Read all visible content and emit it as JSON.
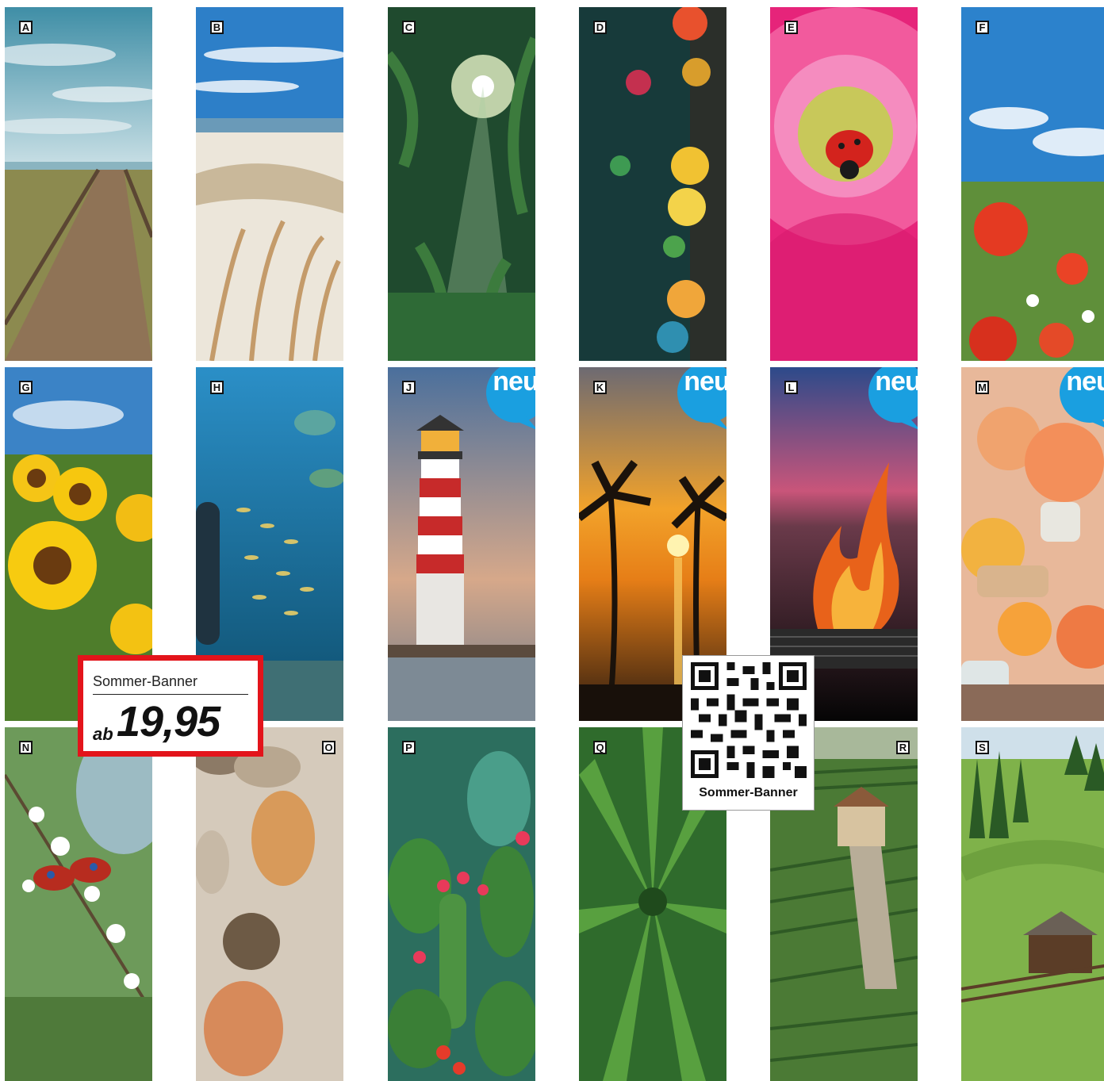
{
  "tiles": [
    {
      "letter": "A",
      "subject": "boardwalk to beach under cloudy sky",
      "is_new": false
    },
    {
      "letter": "B",
      "subject": "sand dunes with beach grass",
      "is_new": false
    },
    {
      "letter": "C",
      "subject": "sunlit jungle with palms",
      "is_new": false
    },
    {
      "letter": "D",
      "subject": "colorful lanterns in garden",
      "is_new": false
    },
    {
      "letter": "E",
      "subject": "pink dahlia with ladybug",
      "is_new": false
    },
    {
      "letter": "F",
      "subject": "poppy field under blue sky",
      "is_new": false
    },
    {
      "letter": "G",
      "subject": "sunflower field",
      "is_new": false
    },
    {
      "letter": "H",
      "subject": "aquarium with fish swarm",
      "is_new": false
    },
    {
      "letter": "J",
      "subject": "red and white lighthouse at pier",
      "is_new": true
    },
    {
      "letter": "K",
      "subject": "palm trees at sunset over sea",
      "is_new": true
    },
    {
      "letter": "L",
      "subject": "barbecue flames at dusk",
      "is_new": true
    },
    {
      "letter": "M",
      "subject": "peach ice tea with fruit",
      "is_new": true
    },
    {
      "letter": "N",
      "subject": "peacock butterfly on blossom branch",
      "is_new": false
    },
    {
      "letter": "O",
      "subject": "sea shells on sand",
      "is_new": false
    },
    {
      "letter": "P",
      "subject": "blooming cactus",
      "is_new": false
    },
    {
      "letter": "Q",
      "subject": "green lily leaves with dew",
      "is_new": false
    },
    {
      "letter": "R",
      "subject": "vineyard with stone house",
      "is_new": false
    },
    {
      "letter": "S",
      "subject": "alpine meadow with wooden hut",
      "is_new": false
    }
  ],
  "badges": {
    "new_label": "neu"
  },
  "price_tag": {
    "title": "Sommer-Banner",
    "prefix": "ab",
    "price": "19,95"
  },
  "qr": {
    "label": "Sommer-Banner"
  },
  "colors": {
    "price_border": "#e3141b",
    "badge": "#1a9fe0"
  }
}
